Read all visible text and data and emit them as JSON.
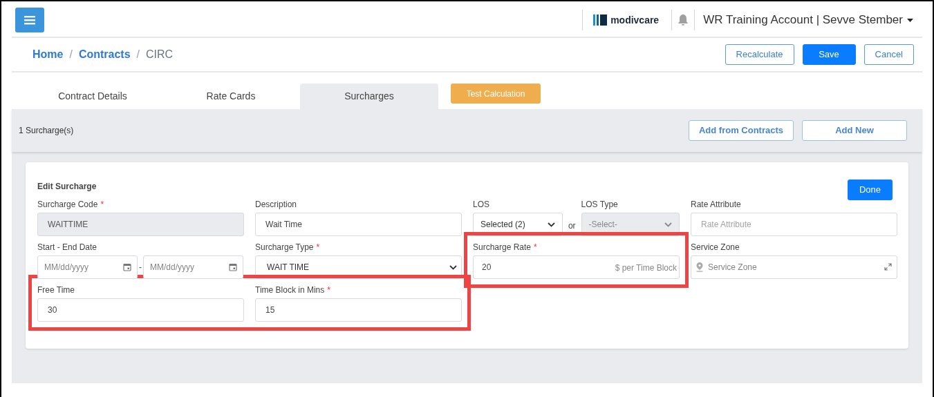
{
  "header": {
    "logo": "modivcare",
    "account": "WR Training Account | Sevve Stember"
  },
  "breadcrumb": [
    {
      "label": "Home",
      "link": true
    },
    {
      "label": "Contracts",
      "link": true
    },
    {
      "label": "CIRC",
      "link": false
    }
  ],
  "breadcrumb_separator": "/",
  "actions": [
    {
      "label": "Recalculate",
      "kind": "outline"
    },
    {
      "label": "Save",
      "kind": "primary"
    },
    {
      "label": "Cancel",
      "kind": "outline"
    }
  ],
  "tabs": [
    {
      "label": "Contract Details",
      "selected": false
    },
    {
      "label": "Rate Cards",
      "selected": false
    },
    {
      "label": "Surcharges",
      "selected": true
    }
  ],
  "test_button": "Test Calculation",
  "summary": {
    "count": "1 Surcharge(s)",
    "buttons": [
      "Add from Contracts",
      "Add New"
    ]
  },
  "edit_card": {
    "title": "Edit Surcharge",
    "done": "Done",
    "rows": [
      {
        "fields": [
          {
            "kind": "text",
            "label": "Surcharge Code",
            "required_mark": "*",
            "value": "WAITTIME",
            "disabled": true,
            "highlighted": false
          },
          {
            "kind": "text",
            "label": "Description",
            "value": "Wait Time",
            "disabled": false,
            "highlighted": false
          },
          {
            "kind": "los",
            "label": "LOS",
            "value": "Selected (2)",
            "connector": "or",
            "type_label": "LOS Type",
            "type_value": "-Select-",
            "type_disabled": true,
            "highlighted": false
          },
          {
            "kind": "text",
            "label": "Rate Attribute",
            "placeholder": "Rate Attribute",
            "disabled": false,
            "highlighted": false
          }
        ]
      },
      {
        "fields": [
          {
            "kind": "date_range",
            "label": "Start - End Date",
            "start_placeholder": "MM/dd/yyyy",
            "separator": "-",
            "end_placeholder": "MM/dd/yyyy",
            "highlighted": false
          },
          {
            "kind": "select",
            "label": "Surcharge Type",
            "required_mark": "*",
            "value": "WAIT TIME",
            "highlighted": false
          },
          {
            "kind": "suffix",
            "label": "Surcharge Rate",
            "required_mark": "*",
            "value": "20",
            "suffix": "$ per Time Block",
            "highlighted": true
          },
          {
            "kind": "location",
            "label": "Service Zone",
            "placeholder": "Service Zone",
            "highlighted": false
          }
        ]
      },
      {
        "fields": [
          {
            "kind": "text",
            "label": "Free Time",
            "value": "30",
            "disabled": false,
            "highlighted": true
          },
          {
            "kind": "text",
            "label": "Time Block in Mins",
            "required_mark": "*",
            "value": "15",
            "disabled": false,
            "highlighted": true
          }
        ]
      }
    ]
  }
}
